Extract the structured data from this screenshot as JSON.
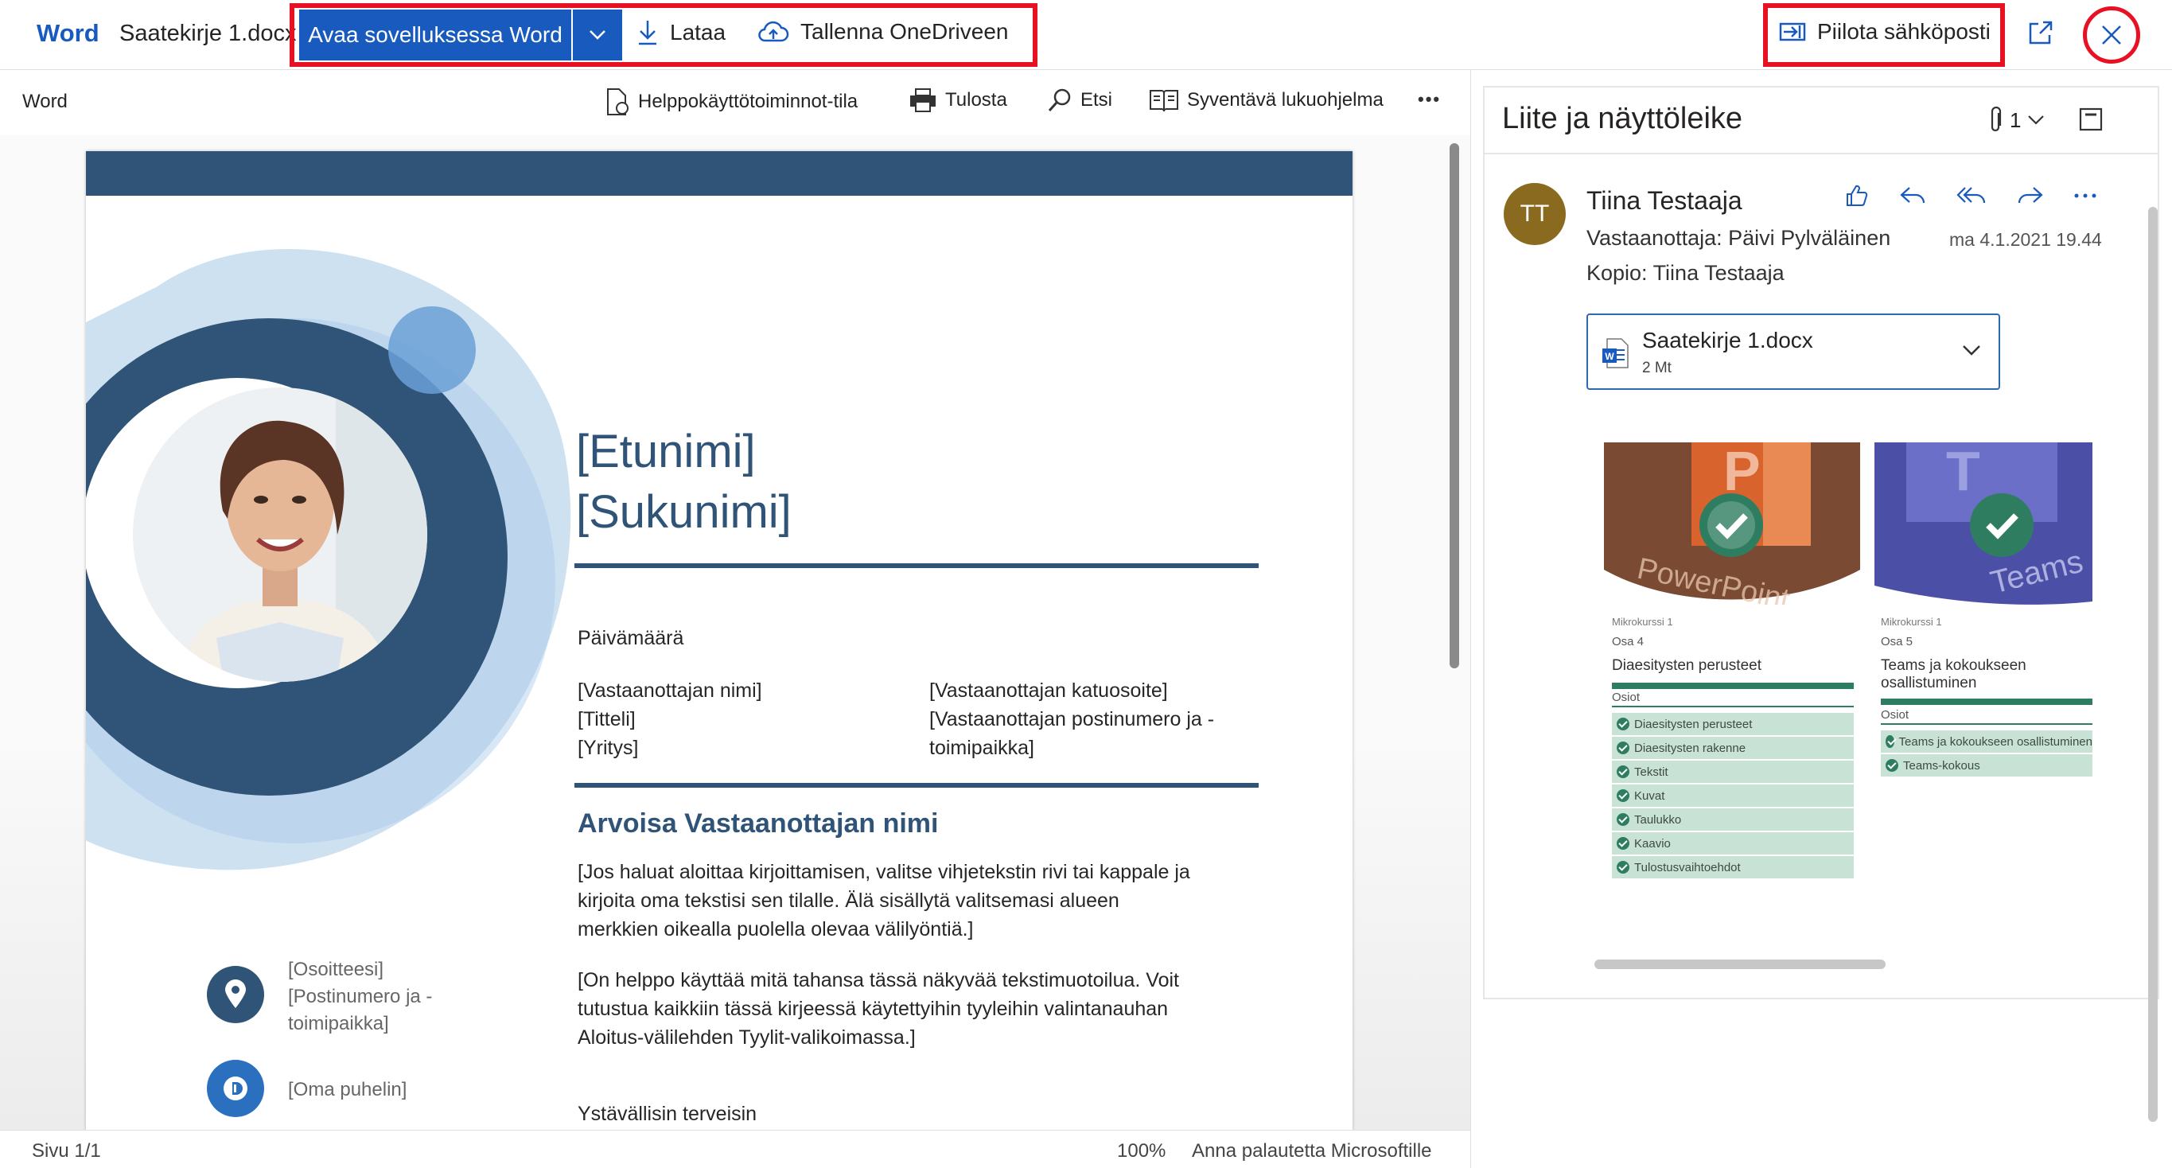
{
  "topbar": {
    "app_name": "Word",
    "file_name": "Saatekirje 1.docx",
    "open_in_word": "Avaa sovelluksessa Word",
    "download": "Lataa",
    "save_onedrive": "Tallenna OneDriveen",
    "hide_email": "Piilota sähköposti"
  },
  "commandbar": {
    "label": "Word",
    "accessibility": "Helppokäyttötoiminnot-tila",
    "print": "Tulosta",
    "find": "Etsi",
    "immersive_reader": "Syventävä lukuohjelma",
    "more": "•••"
  },
  "document": {
    "name_line1": "[Etunimi]",
    "name_line2": "[Sukunimi]",
    "date": "Päivämäärä",
    "recipient_name": "[Vastaanottajan nimi]",
    "recipient_title": "[Titteli]",
    "recipient_company": "[Yritys]",
    "recipient_street": "[Vastaanottajan katuosoite]",
    "recipient_postal_1": "[Vastaanottajan postinumero ja -",
    "recipient_postal_2": "toimipaikka]",
    "salutation": "Arvoisa Vastaanottajan nimi",
    "body1_l1": "[Jos haluat aloittaa kirjoittamisen, valitse vihjetekstin rivi tai kappale ja",
    "body1_l2": "kirjoita oma tekstisi sen tilalle. Älä sisällytä valitsemasi alueen",
    "body1_l3": "merkkien oikealla puolella olevaa välilyöntiä.]",
    "body2_l1": "[On helppo käyttää mitä tahansa tässä näkyvää tekstimuotoilua. Voit",
    "body2_l2": "tutustua kaikkiin tässä kirjeessä käytettyihin tyyleihin valintanauhan",
    "body2_l3": "Aloitus-välilehden Tyylit-valikoimassa.]",
    "closing": "Ystävällisin terveisin",
    "address_l1": "[Osoitteesi]",
    "address_l2": "[Postinumero ja -",
    "address_l3": "toimipaikka]",
    "phone": "[Oma puhelin]"
  },
  "status": {
    "page": "Sivu 1/1",
    "zoom": "100%",
    "feedback": "Anna palautetta Microsoftille"
  },
  "pane": {
    "title": "Liite ja näyttöleike",
    "attachment_count": "1",
    "sender_initials": "TT",
    "sender": "Tiina Testaaja",
    "to": "Vastaanottaja:  Päivi Pylväläinen",
    "cc": "Kopio:  Tiina Testaaja",
    "date": "ma 4.1.2021 19.44",
    "attachment_name": "Saatekirje 1.docx",
    "attachment_size": "2 Mt",
    "card1": {
      "icon_text": "PowerPoint",
      "course": "Mikrokurssi 1",
      "part": "Osa 4",
      "title": "Diaesitysten perusteet",
      "section": "Osiot",
      "items": [
        "Diaesitysten perusteet",
        "Diaesitysten rakenne",
        "Tekstit",
        "Kuvat",
        "Taulukko",
        "Kaavio",
        "Tulostusvaihtoehdot"
      ]
    },
    "card2": {
      "icon_text": "Teams",
      "course": "Mikrokurssi 1",
      "part": "Osa 5",
      "title_l1": "Teams ja kokoukseen",
      "title_l2": "osallistuminen",
      "section": "Osiot",
      "items": [
        "Teams ja kokoukseen osallistuminen",
        "Teams-kokous"
      ]
    }
  },
  "colors": {
    "word_blue": "#185abd",
    "doc_navy": "#2f5478",
    "highlight_red": "#e81123",
    "avatar": "#8a6a1f"
  }
}
